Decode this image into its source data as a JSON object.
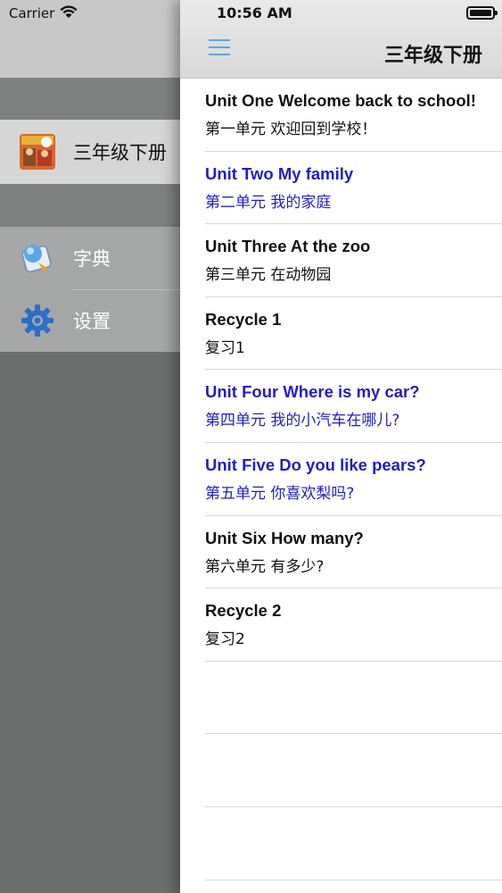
{
  "status_bar": {
    "carrier": "Carrier",
    "time": "10:56 AM"
  },
  "drawer": {
    "book": {
      "label": "三年级下册",
      "icon": "book-cover-icon"
    },
    "items": [
      {
        "label": "字典",
        "icon": "dictionary-icon"
      },
      {
        "label": "设置",
        "icon": "gear-icon"
      }
    ]
  },
  "navbar": {
    "title": "三年级下册",
    "menu_icon": "hamburger-menu-icon"
  },
  "units": [
    {
      "en": "Unit One Welcome back to school!",
      "cn": "第一单元 欢迎回到学校！",
      "highlighted": false
    },
    {
      "en": "Unit Two My family",
      "cn": "第二单元 我的家庭",
      "highlighted": true
    },
    {
      "en": "Unit Three At the zoo",
      "cn": "第三单元 在动物园",
      "highlighted": false
    },
    {
      "en": "Recycle 1",
      "cn": "复习1",
      "highlighted": false
    },
    {
      "en": "Unit Four Where is my car?",
      "cn": "第四单元 我的小汽车在哪儿?",
      "highlighted": true
    },
    {
      "en": "Unit Five Do you like pears?",
      "cn": "第五单元 你喜欢梨吗?",
      "highlighted": true
    },
    {
      "en": "Unit Six How many?",
      "cn": "第六单元 有多少?",
      "highlighted": false
    },
    {
      "en": "Recycle 2",
      "cn": "复习2",
      "highlighted": false
    }
  ],
  "colors": {
    "highlight": "#1f1fc6",
    "menu_icon": "#5aa7e6"
  }
}
